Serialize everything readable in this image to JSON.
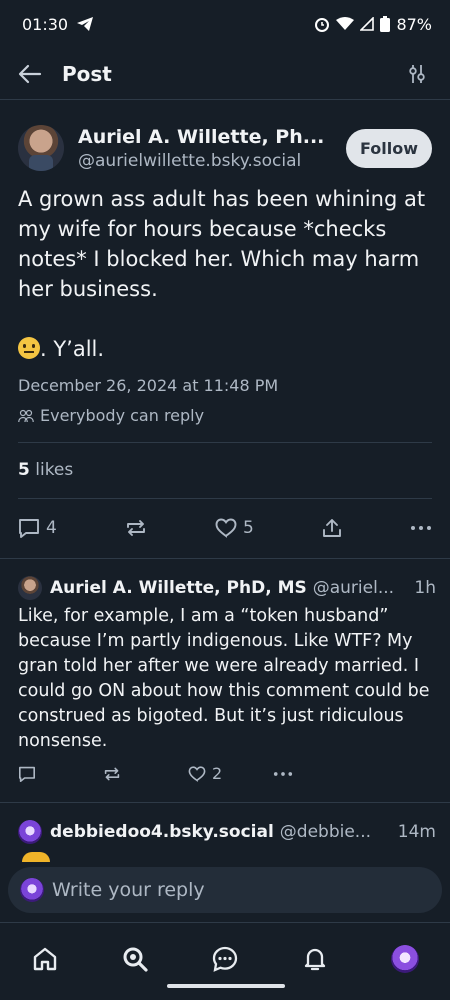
{
  "status": {
    "time": "01:30",
    "battery": "87%"
  },
  "header": {
    "title": "Post"
  },
  "post": {
    "author_name": "Auriel A. Willette, Ph...",
    "author_handle": "@aurielwillette.bsky.social",
    "follow_label": "Follow",
    "text_main": "A grown ass adult has been whining at my wife for hours because *checks notes* I blocked her. Which may harm her business.",
    "text_tail": ". Y’all.",
    "date": "December 26, 2024 at 11:48 PM",
    "reply_setting": "Everybody can reply",
    "likes_count": "5",
    "likes_label": "likes",
    "reply_count": "4",
    "like_count": "5"
  },
  "reply": {
    "author_name": "Auriel A. Willette, PhD, MS",
    "author_handle": "@auriel...",
    "time": "1h",
    "text": "Like, for example, I am a “token husband” because I’m partly indigenous. Like WTF? My gran told her after we were already married. I could go ON about how this comment could be construed as bigoted. But it’s just ridiculous nonsense.",
    "like_count": "2"
  },
  "reply2": {
    "author_name": "debbiedoo4.bsky.social",
    "author_handle": "@debbie...",
    "time": "14m"
  },
  "composer": {
    "placeholder": "Write your reply"
  },
  "nav": {
    "items": [
      "home-icon",
      "search-icon",
      "chat-icon",
      "bell-icon",
      "profile-avatar"
    ]
  },
  "colors": {
    "background": "#161e27",
    "text": "#f1f3f5",
    "muted": "#aeb8c4",
    "divider": "#2e3a47",
    "follow_bg": "#e1e5ea"
  }
}
